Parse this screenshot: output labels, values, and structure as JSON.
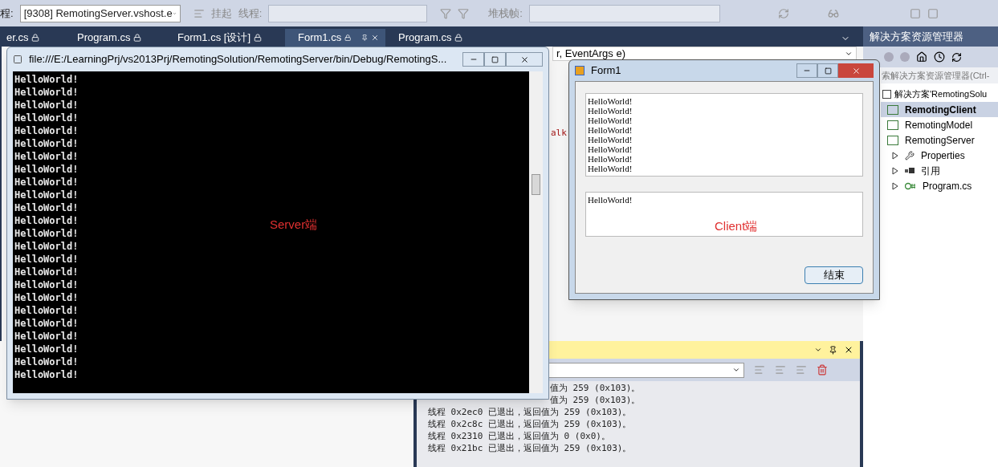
{
  "toolbar": {
    "process_label": "程:",
    "process": "[9308] RemotingServer.vshost.e",
    "suspend": "挂起",
    "thread_label": "线程:",
    "stack_label": "堆栈帧:"
  },
  "tabs": [
    {
      "label": "er.cs",
      "selected": false
    },
    {
      "label": "Program.cs",
      "selected": false
    },
    {
      "label": "Form1.cs [设计]",
      "selected": false
    },
    {
      "label": "Form1.cs",
      "selected": true
    },
    {
      "label": "Program.cs",
      "selected": false
    }
  ],
  "editor": {
    "member_dropdown": "r, EventArgs e)",
    "code_fragment": "alk"
  },
  "output": {
    "lines": [
      {
        "text": "值为 259 (0x103)。",
        "kind": "partial"
      },
      {
        "text": "值为 259 (0x103)。",
        "kind": "partial"
      },
      {
        "text": "线程 0x2ec0 已退出，返回值为 259 (0x103)。",
        "kind": "full"
      },
      {
        "text": "线程 0x2c8c 已退出，返回值为 259 (0x103)。",
        "kind": "full"
      },
      {
        "text": "线程 0x2310 已退出，返回值为 0 (0x0)。",
        "kind": "full"
      },
      {
        "text": "线程 0x21bc 已退出，返回值为 259 (0x103)。",
        "kind": "full"
      }
    ]
  },
  "solution_explorer": {
    "title": "解决方案资源管理器",
    "search_placeholder": "索解决方案资源管理器(Ctrl-",
    "tree": [
      {
        "label": "解决方案'RemotingSolu",
        "kind": "solution",
        "selected": false,
        "children": [
          {
            "label": "RemotingClient",
            "kind": "project",
            "selected": true
          },
          {
            "label": "RemotingModel",
            "kind": "project",
            "selected": false
          },
          {
            "label": "RemotingServer",
            "kind": "project",
            "selected": false,
            "children": [
              {
                "label": "Properties",
                "kind": "properties",
                "selected": false,
                "expanded": false
              },
              {
                "label": "引用",
                "kind": "references",
                "selected": false,
                "expanded": false
              },
              {
                "label": "Program.cs",
                "kind": "file",
                "selected": false,
                "expanded": false
              }
            ]
          }
        ]
      }
    ]
  },
  "console": {
    "title": "file:///E:/LearningPrj/vs2013Prj/RemotingSolution/RemotingServer/bin/Debug/RemotingS...",
    "annotation": "Server端",
    "lines": [
      "HelloWorld!",
      "HelloWorld!",
      "HelloWorld!",
      "HelloWorld!",
      "HelloWorld!",
      "HelloWorld!",
      "HelloWorld!",
      "HelloWorld!",
      "HelloWorld!",
      "HelloWorld!",
      "HelloWorld!",
      "HelloWorld!",
      "HelloWorld!",
      "HelloWorld!",
      "HelloWorld!",
      "HelloWorld!",
      "HelloWorld!",
      "HelloWorld!",
      "HelloWorld!",
      "HelloWorld!",
      "HelloWorld!",
      "HelloWorld!",
      "HelloWorld!",
      "HelloWorld!"
    ]
  },
  "form": {
    "title": "Form1",
    "log_lines": [
      "HelloWorld!",
      "HelloWorld!",
      "HelloWorld!",
      "HelloWorld!",
      "HelloWorld!",
      "HelloWorld!",
      "HelloWorld!",
      "HelloWorld!"
    ],
    "input_text": "HelloWorld!",
    "annotation": "Client端",
    "button": "结束"
  }
}
